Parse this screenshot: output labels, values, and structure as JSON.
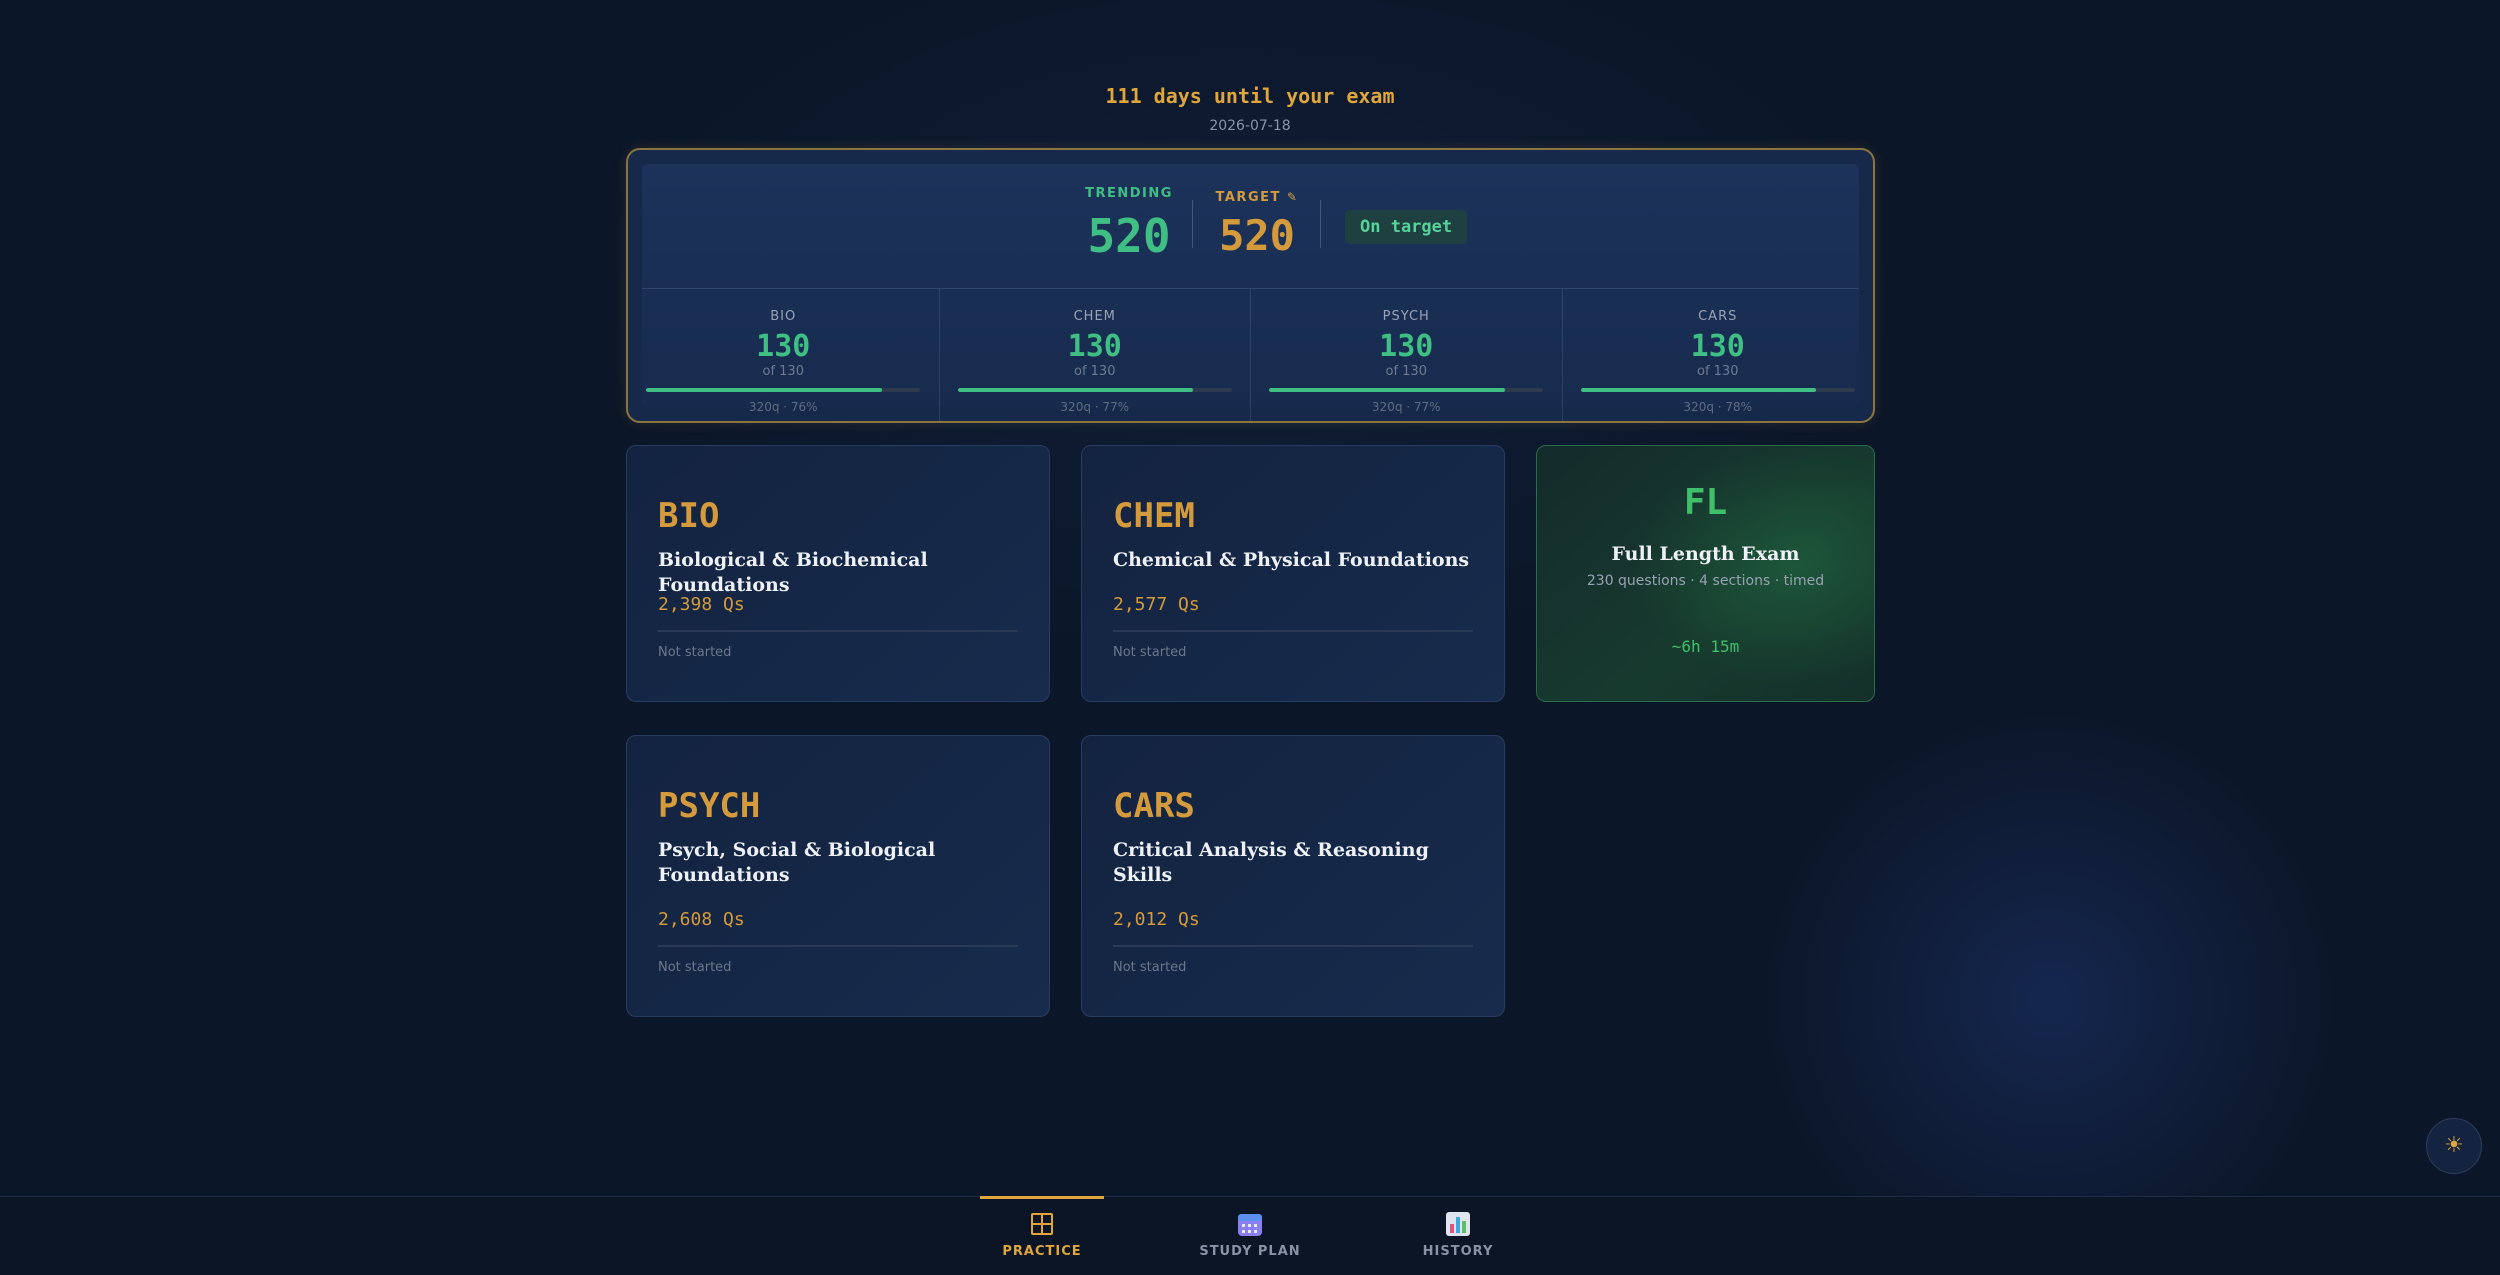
{
  "header": {
    "countdown": "111 days until your exam",
    "exam_date": "2026-07-18"
  },
  "score_panel": {
    "trending_label": "TRENDING",
    "trending_value": "520",
    "target_label": "TARGET",
    "target_value": "520",
    "status": "On target",
    "sections": [
      {
        "name": "BIO",
        "score": "130",
        "of": "of 130",
        "progress": 0.86,
        "stats": "320q · 76%"
      },
      {
        "name": "CHEM",
        "score": "130",
        "of": "of 130",
        "progress": 0.86,
        "stats": "320q · 77%"
      },
      {
        "name": "PSYCH",
        "score": "130",
        "of": "of 130",
        "progress": 0.86,
        "stats": "320q · 77%"
      },
      {
        "name": "CARS",
        "score": "130",
        "of": "of 130",
        "progress": 0.86,
        "stats": "320q · 78%"
      }
    ]
  },
  "cards": [
    {
      "code": "BIO",
      "title": "Biological & Biochemical Foundations",
      "count": "2,398 Qs",
      "status": "Not started"
    },
    {
      "code": "CHEM",
      "title": "Chemical & Physical Foundations",
      "count": "2,577 Qs",
      "status": "Not started"
    },
    {
      "code": "PSYCH",
      "title": "Psych, Social & Biological Foundations",
      "count": "2,608 Qs",
      "status": "Not started"
    },
    {
      "code": "CARS",
      "title": "Critical Analysis & Reasoning Skills",
      "count": "2,012 Qs",
      "status": "Not started"
    }
  ],
  "full_length": {
    "code": "FL",
    "title": "Full Length Exam",
    "subtitle": "230 questions · 4 sections · timed",
    "duration": "~6h 15m"
  },
  "theme_toggle_icon": "sun-icon",
  "nav": [
    {
      "label": "PRACTICE",
      "icon": "grid-icon",
      "active": true
    },
    {
      "label": "STUDY PLAN",
      "icon": "calendar-icon",
      "active": false
    },
    {
      "label": "HISTORY",
      "icon": "bar-chart-icon",
      "active": false
    }
  ],
  "colors": {
    "accent": "#e0a63c",
    "success": "#3fbf83",
    "background": "#0b1628"
  }
}
